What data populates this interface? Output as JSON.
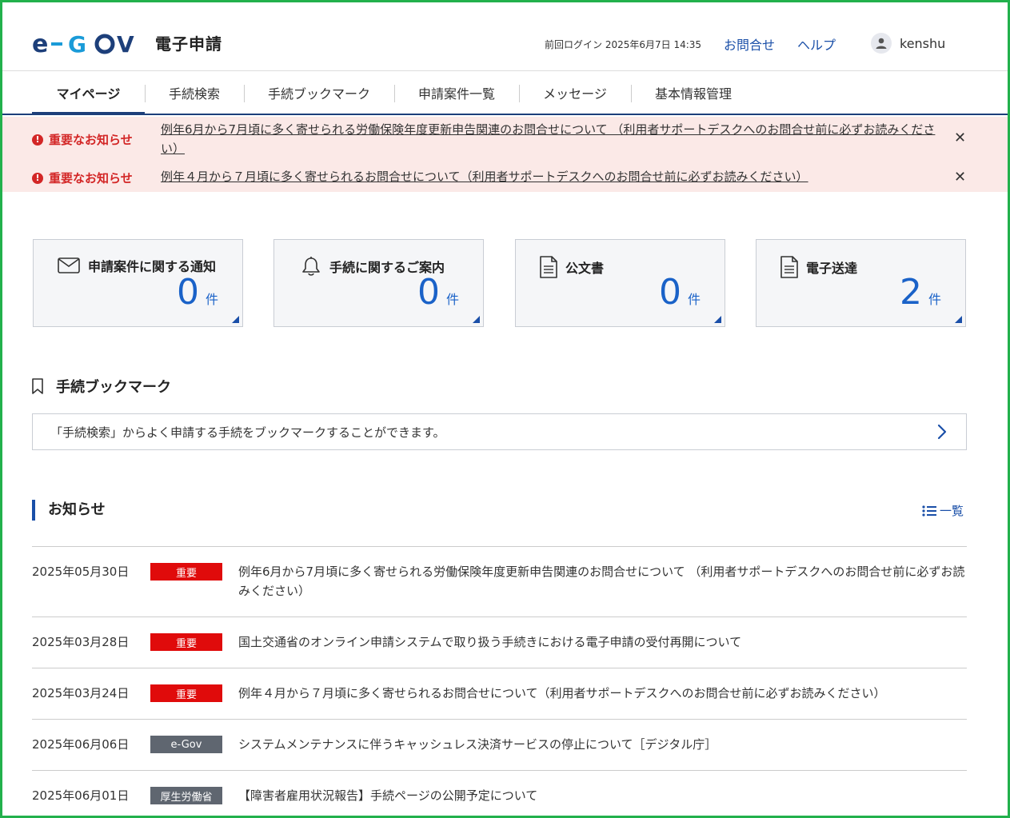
{
  "colors": {
    "brand": "#1a4fa8",
    "alert": "#d32626",
    "alert_bg": "#fbe9e7",
    "count": "#1a62c8",
    "tag_important": "#e00b0b",
    "tag_gray": "#5f6670"
  },
  "header": {
    "logo_text": "e-GOV",
    "subtitle": "電子申請",
    "last_login": "前回ログイン 2025年6月7日 14:35",
    "contact": "お問合せ",
    "help": "ヘルプ",
    "user_name": "kenshu"
  },
  "nav": {
    "items": [
      {
        "label": "マイページ"
      },
      {
        "label": "手続検索"
      },
      {
        "label": "手続ブックマーク"
      },
      {
        "label": "申請案件一覧"
      },
      {
        "label": "メッセージ"
      },
      {
        "label": "基本情報管理"
      }
    ]
  },
  "alerts": [
    {
      "label": "重要なお知らせ",
      "text": "例年6月から7月頃に多く寄せられる労働保険年度更新申告関連のお問合せについて （利用者サポートデスクへのお問合せ前に必ずお読みください）"
    },
    {
      "label": "重要なお知らせ",
      "text": "例年４月から７月頃に多く寄せられるお問合せについて（利用者サポートデスクへのお問合せ前に必ずお読みください）"
    }
  ],
  "cards": [
    {
      "title": "申請案件に関する通知",
      "count": "0",
      "unit": "件",
      "icon": "envelope-icon"
    },
    {
      "title": "手続に関するご案内",
      "count": "0",
      "unit": "件",
      "icon": "bell-icon"
    },
    {
      "title": "公文書",
      "count": "0",
      "unit": "件",
      "icon": "document-icon"
    },
    {
      "title": "電子送達",
      "count": "2",
      "unit": "件",
      "icon": "document-icon"
    }
  ],
  "bookmark": {
    "title": "手続ブックマーク",
    "message": "「手続検索」からよく申請する手続をブックマークすることができます。"
  },
  "news": {
    "title": "お知らせ",
    "all_label": "一覧",
    "items": [
      {
        "date": "2025年05月30日",
        "tag": "重要",
        "tag_type": "important",
        "text": "例年6月から7月頃に多く寄せられる労働保険年度更新申告関連のお問合せについて （利用者サポートデスクへのお問合せ前に必ずお読みください）"
      },
      {
        "date": "2025年03月28日",
        "tag": "重要",
        "tag_type": "important",
        "text": "国土交通省のオンライン申請システムで取り扱う手続きにおける電子申請の受付再開について"
      },
      {
        "date": "2025年03月24日",
        "tag": "重要",
        "tag_type": "important",
        "text": "例年４月から７月頃に多く寄せられるお問合せについて（利用者サポートデスクへのお問合せ前に必ずお読みください）"
      },
      {
        "date": "2025年06月06日",
        "tag": "e-Gov",
        "tag_type": "gray",
        "text": "システムメンテナンスに伴うキャッシュレス決済サービスの停止について［デジタル庁］"
      },
      {
        "date": "2025年06月01日",
        "tag": "厚生労働省",
        "tag_type": "gray",
        "text": "【障害者雇用状況報告】手続ページの公開予定について"
      }
    ]
  }
}
